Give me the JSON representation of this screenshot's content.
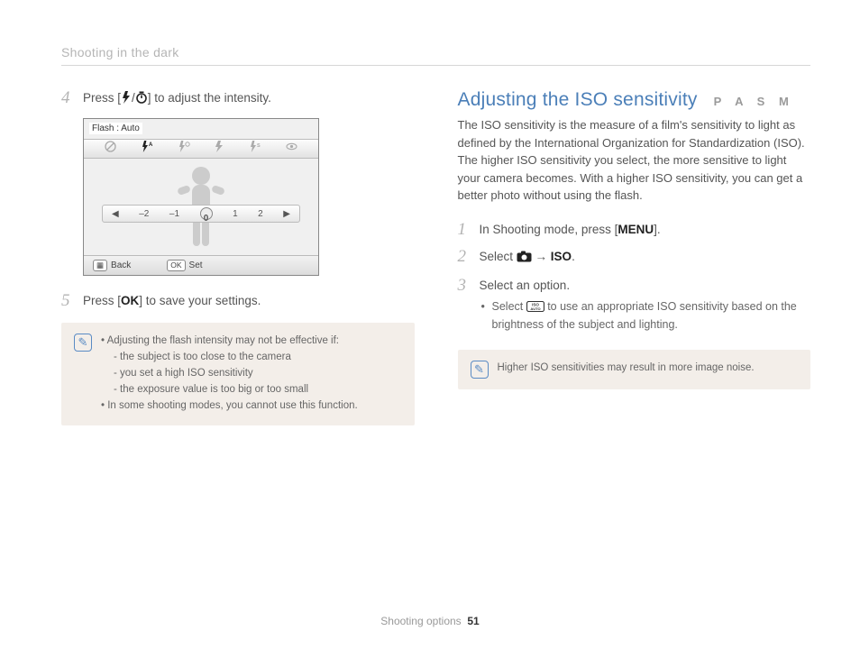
{
  "header": "Shooting in the dark",
  "left": {
    "step4": {
      "num": "4",
      "text_before": "Press [",
      "text_mid": "/",
      "text_after": "] to adjust the intensity.",
      "icon1": "flash-icon",
      "icon2": "timer-icon"
    },
    "lcd": {
      "label": "Flash : Auto",
      "top_options": [
        "flash-off",
        "flash-auto",
        "flash-auto-redeye",
        "flash-fill",
        "flash-slow",
        "redeye"
      ],
      "slider_ticks": [
        "–2",
        "–1",
        "0",
        "1",
        "2"
      ],
      "bottom_back_label": "Back",
      "bottom_set_label": "Set",
      "bottom_back_icon": "menu-button-icon",
      "bottom_set_icon": "ok-button-icon"
    },
    "step5": {
      "num": "5",
      "text_before": "Press [",
      "ok_label": "OK",
      "text_after": "] to save your settings."
    },
    "note": {
      "lines": [
        {
          "cls": "top",
          "text": "Adjusting the flash intensity may not be effective if:"
        },
        {
          "cls": "sub",
          "text": "the subject is too close to the camera"
        },
        {
          "cls": "sub",
          "text": "you set a high ISO sensitivity"
        },
        {
          "cls": "sub",
          "text": "the exposure value is too big or too small"
        },
        {
          "cls": "top",
          "text": "In some shooting modes, you cannot use this function."
        }
      ]
    }
  },
  "right": {
    "title": "Adjusting the ISO sensitivity",
    "modes": "P A S M",
    "desc": "The ISO sensitivity is the measure of a film's sensitivity to light as defined by the International Organization for Standardization (ISO). The higher ISO sensitivity you select, the more sensitive to light your camera becomes. With a higher ISO sensitivity, you can get a better photo without using the flash.",
    "step1": {
      "num": "1",
      "before": "In Shooting mode, press [",
      "menu": "MENU",
      "after": "]."
    },
    "step2": {
      "num": "2",
      "before": "Select ",
      "arrow": " → ",
      "iso": "ISO",
      "after": "."
    },
    "step3": {
      "num": "3",
      "text": "Select an option.",
      "sub_before": "Select ",
      "sub_after": " to use an appropriate ISO sensitivity based on the brightness of the subject and lighting."
    },
    "note": "Higher ISO sensitivities may result in more image noise."
  },
  "footer": {
    "section": "Shooting options",
    "page": "51"
  }
}
